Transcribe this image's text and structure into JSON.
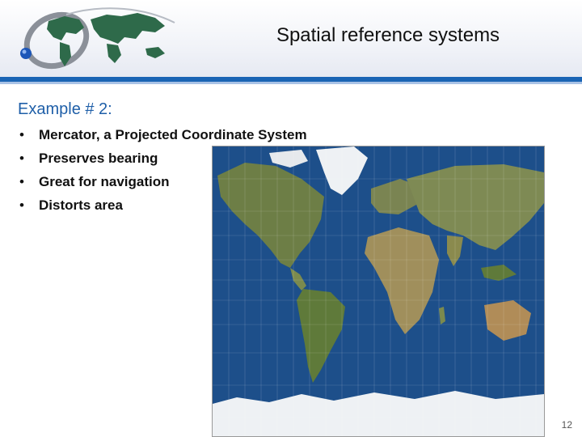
{
  "slide": {
    "title": "Spatial reference systems",
    "subtitle": "Example # 2:",
    "bullets": [
      "Mercator, a Projected Coordinate System",
      "Preserves bearing",
      "Great for navigation",
      "Distorts area"
    ],
    "page_number": "12"
  },
  "icons": {
    "logo": "globe-world-map-logo",
    "map": "mercator-world-map"
  },
  "colors": {
    "accent_bar": "#1a64b4",
    "subtitle": "#1f5fa8",
    "logo_land": "#2e6a4a",
    "ocean": "#1d4f8a",
    "land": "#6d7e46",
    "ice": "#eef1f4"
  }
}
